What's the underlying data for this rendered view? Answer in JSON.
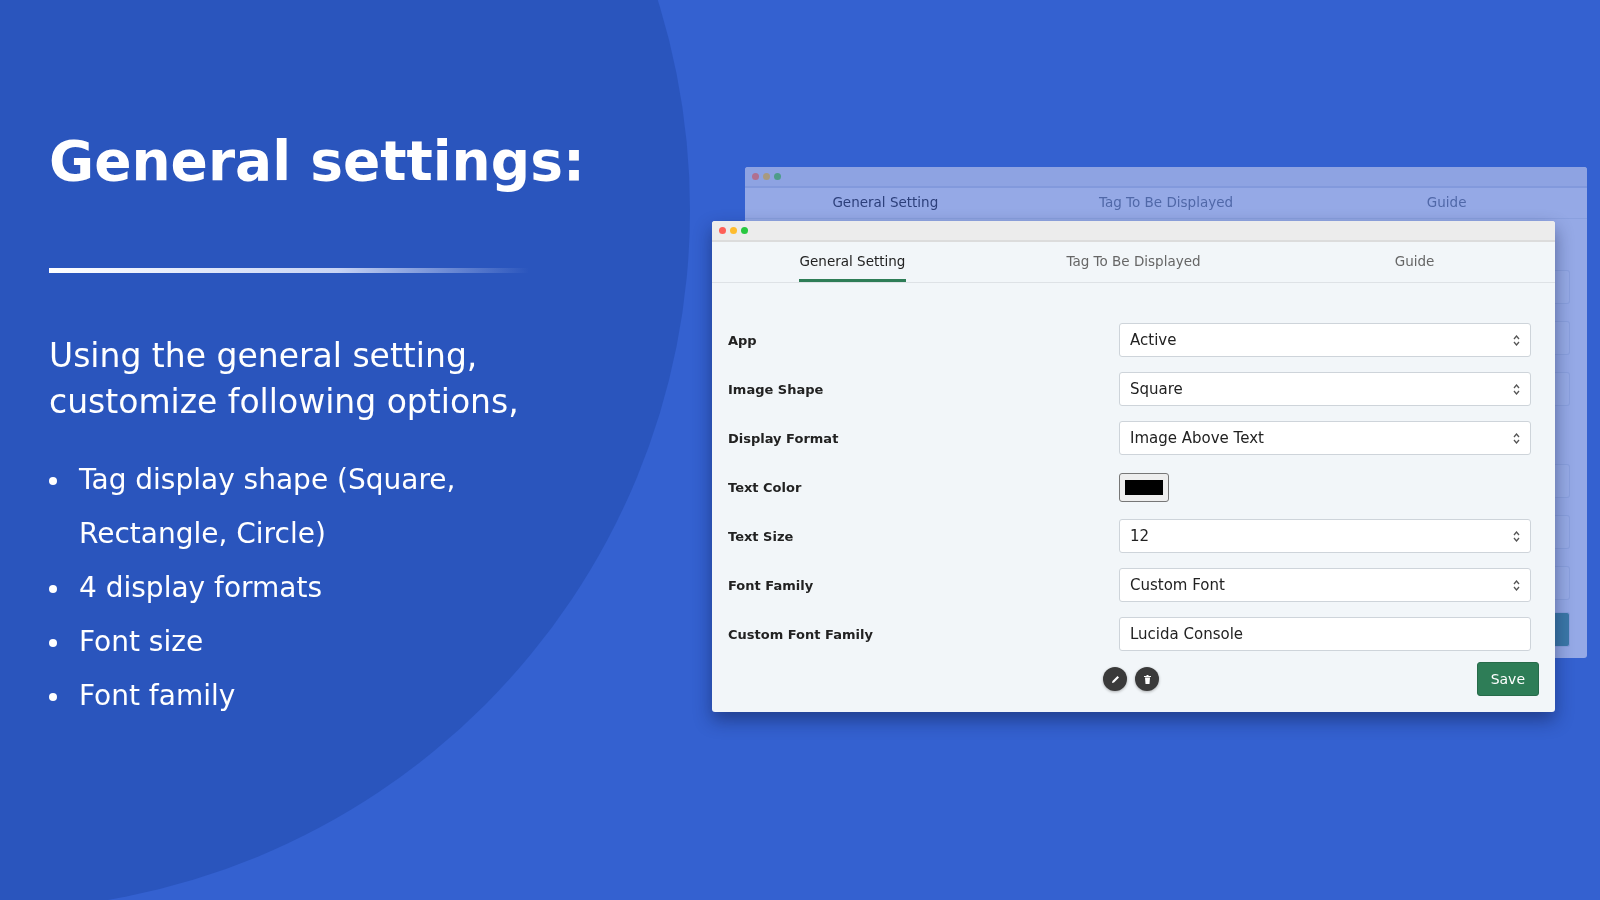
{
  "heading": "General settings:",
  "intro": "Using the general setting, customize following options,",
  "bullets": [
    "Tag display shape (Square, Rectangle, Circle)",
    "4 display formats",
    "Font size",
    "Font family"
  ],
  "back_window": {
    "tabs": [
      {
        "label": "General Setting",
        "selected": true
      },
      {
        "label": "Tag To Be Displayed",
        "selected": false
      },
      {
        "label": "Guide",
        "selected": false
      }
    ]
  },
  "window": {
    "tabs": [
      {
        "label": "General Setting",
        "selected": true
      },
      {
        "label": "Tag To Be Displayed",
        "selected": false
      },
      {
        "label": "Guide",
        "selected": false
      }
    ],
    "fields": [
      {
        "kind": "select",
        "label": "App",
        "value": "Active"
      },
      {
        "kind": "select",
        "label": "Image Shape",
        "value": "Square"
      },
      {
        "kind": "select",
        "label": "Display Format",
        "value": "Image Above Text"
      },
      {
        "kind": "color",
        "label": "Text Color",
        "color": "#000000"
      },
      {
        "kind": "select",
        "label": "Text Size",
        "value": "12"
      },
      {
        "kind": "select",
        "label": "Font Family",
        "value": "Custom Font"
      },
      {
        "kind": "text",
        "label": "Custom Font Family",
        "value": "Lucida Console"
      }
    ],
    "save_button": "Save"
  }
}
